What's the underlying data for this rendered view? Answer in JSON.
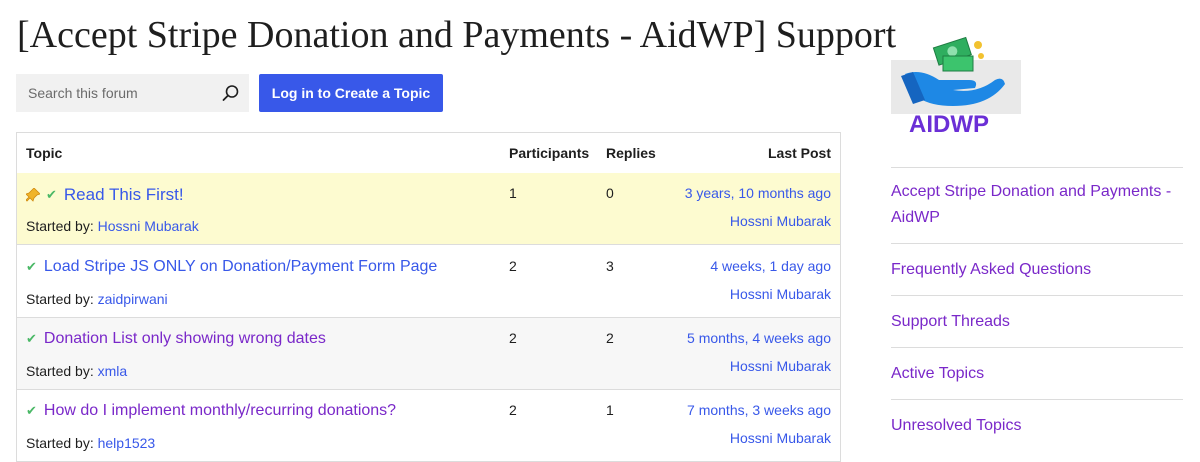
{
  "page": {
    "title": "[Accept Stripe Donation and Payments - AidWP] Support"
  },
  "search": {
    "placeholder": "Search this forum",
    "icon": "search-icon"
  },
  "create_topic": {
    "label": "Log in to Create a Topic"
  },
  "table": {
    "headers": {
      "topic": "Topic",
      "participants": "Participants",
      "replies": "Replies",
      "last_post": "Last Post"
    },
    "started_by_label": "Started by:",
    "rows": [
      {
        "title": "Read This First!",
        "sticky": true,
        "resolved": true,
        "author": "Hossni Mubarak",
        "participants": "1",
        "replies": "0",
        "last_time": "3 years, 10 months ago",
        "last_author": "Hossni Mubarak"
      },
      {
        "title": "Load Stripe JS ONLY on Donation/Payment Form Page",
        "sticky": false,
        "resolved": true,
        "author": "zaidpirwani",
        "participants": "2",
        "replies": "3",
        "last_time": "4 weeks, 1 day ago",
        "last_author": "Hossni Mubarak"
      },
      {
        "title": "Donation List only showing wrong dates",
        "sticky": false,
        "resolved": true,
        "author": "xmla",
        "participants": "2",
        "replies": "2",
        "last_time": "5 months, 4 weeks ago",
        "last_author": "Hossni Mubarak"
      },
      {
        "title": "How do I implement monthly/recurring donations?",
        "sticky": false,
        "resolved": true,
        "author": "help1523",
        "participants": "2",
        "replies": "1",
        "last_time": "7 months, 3 weeks ago",
        "last_author": "Hossni Mubarak"
      }
    ]
  },
  "logo": {
    "text": "AIDWP"
  },
  "sidebar": {
    "items": [
      {
        "label": "Accept Stripe Donation and Payments - AidWP"
      },
      {
        "label": "Frequently Asked Questions"
      },
      {
        "label": "Support Threads"
      },
      {
        "label": "Active Topics"
      },
      {
        "label": "Unresolved Topics"
      }
    ]
  },
  "colors": {
    "accent": "#3858e9",
    "visited_link": "#7a28c9",
    "sticky_bg": "#fdfbd0",
    "resolved_check": "#4ab866",
    "logo_purple": "#6b2fd6"
  }
}
